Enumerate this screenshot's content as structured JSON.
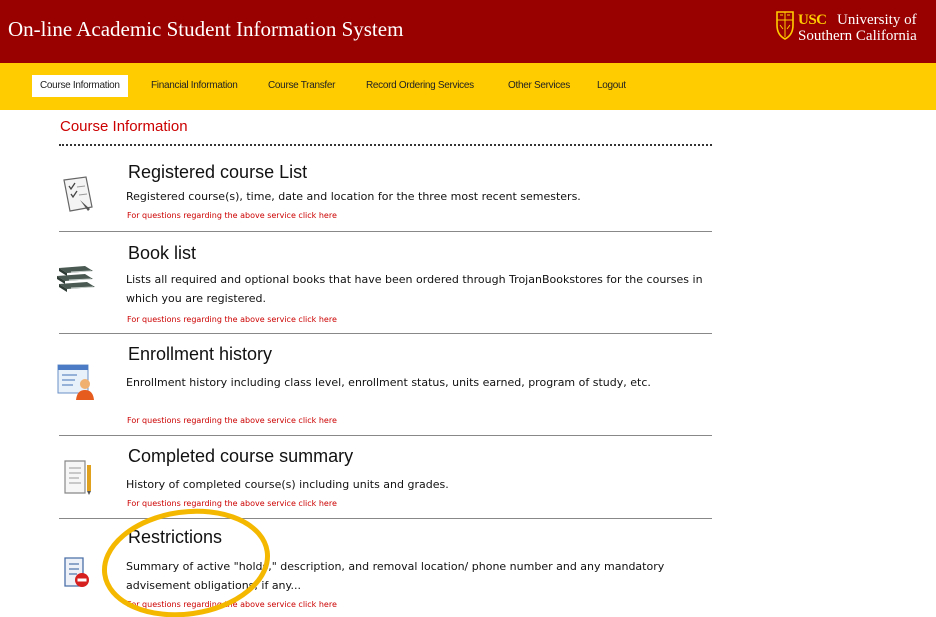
{
  "header": {
    "title": "On-line Academic Student Information System",
    "logo": {
      "usc": "USC",
      "line1": "University of",
      "line2": "Southern California"
    },
    "bg_color": "#990000"
  },
  "nav": {
    "items": [
      {
        "label": "Course Information",
        "active": true
      },
      {
        "label": "Financial Information"
      },
      {
        "label": "Course Transfer"
      },
      {
        "label": "Record Ordering Services"
      },
      {
        "label": "Other Services"
      },
      {
        "label": "Logout"
      }
    ],
    "bg_color": "#ffcc00"
  },
  "main": {
    "heading": "Course Information",
    "items": [
      {
        "title": "Registered course List",
        "desc": "Registered course(s), time, date and location for the three most recent semesters.",
        "link": "For questions regarding the above service click here",
        "icon": "checklist-icon"
      },
      {
        "title": "Book list",
        "desc": "Lists all required and optional books that have been ordered through TrojanBookstores for the courses in which you are registered.",
        "link": "For questions regarding the above service click here",
        "icon": "books-icon"
      },
      {
        "title": "Enrollment history",
        "desc": "Enrollment history including class level, enrollment status, units earned, program of study, etc.",
        "link": "For questions regarding the above service click here",
        "icon": "student-record-icon"
      },
      {
        "title": "Completed course summary",
        "desc": "History of completed course(s) including units and grades.",
        "link": "For questions regarding the above service click here",
        "icon": "report-icon"
      },
      {
        "title": "Restrictions",
        "desc": "Summary of active \"holds,\" description, and removal location/ phone number and any mandatory advisement obligations, if any...",
        "link": "For questions regarding the above service click here",
        "icon": "restriction-icon"
      }
    ]
  },
  "annotation": {
    "shape": "ellipse",
    "color": "#f5b800",
    "target": "Restrictions"
  }
}
